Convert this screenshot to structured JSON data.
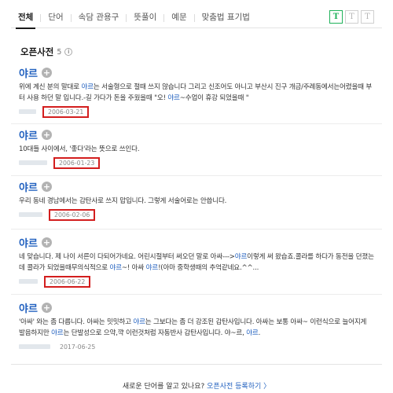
{
  "tabs": [
    {
      "label": "전체",
      "active": true
    },
    {
      "label": "단어",
      "active": false
    },
    {
      "label": "속담 관용구",
      "active": false
    },
    {
      "label": "뜻풀이",
      "active": false
    },
    {
      "label": "예문",
      "active": false
    },
    {
      "label": "맞춤법 표기법",
      "active": false
    }
  ],
  "font_buttons": [
    "T",
    "T",
    "T"
  ],
  "section": {
    "title": "오픈사전",
    "count": "5",
    "info_icon": "i"
  },
  "entries": [
    {
      "word": "야르",
      "definition": [
        {
          "t": "위에 계신 분의 말대로 "
        },
        {
          "t": "야르",
          "hl": true
        },
        {
          "t": "는 서술형으로 절때 쓰지 않습니다 그리고 신조어도 아니고 부산시 진구 개금/주례동에서는어렸을때 부터 사용 하던 말 입니다.-길 가다가 돈을 주웠을때 \"오! "
        },
        {
          "t": "야르",
          "hl": true
        },
        {
          "t": "~수업이 휴강 되었을때 \""
        }
      ],
      "date": "2006-03-21",
      "highlighted_date": true
    },
    {
      "word": "야르",
      "definition": [
        {
          "t": "10대들 사이에서, '좋다'라는 뜻으로 쓰인다."
        }
      ],
      "date": "2006-01-23",
      "highlighted_date": true
    },
    {
      "word": "야르",
      "definition": [
        {
          "t": "우리 동네 경남에서는 감탄사로 쓰지 맙입니다. 그렇게 서술어로는 안씁니다."
        }
      ],
      "date": "2006-02-06",
      "highlighted_date": true
    },
    {
      "word": "야르",
      "definition": [
        {
          "t": "네 맞습니다. 제 나이 서른이 다되어가네요. 어린시절부터 써오던 말로 아싸--->"
        },
        {
          "t": "야르",
          "hl": true
        },
        {
          "t": "이렇게 써 왔습죠.콜라를 하다가 동전을 던졌는데 콜라가 되었을때무의식적으로 "
        },
        {
          "t": "야르",
          "hl": true
        },
        {
          "t": "~! 아싸 "
        },
        {
          "t": "야르",
          "hl": true
        },
        {
          "t": "!(아마 중학생때의 추억같네요.^^..."
        }
      ],
      "date": "2006-06-22",
      "highlighted_date": true
    },
    {
      "word": "야르",
      "definition": [
        {
          "t": "'아싸' 와는 좀 다릅니다. 아싸는 밋밋하고 "
        },
        {
          "t": "야르",
          "hl": true
        },
        {
          "t": "는 그보다는 좀 더 강조된 감탄사입니다. 아싸는 보통 아싸~ 이런식으로 늘어지게 발음하지만 "
        },
        {
          "t": "야르",
          "hl": true
        },
        {
          "t": "는 단발성으로 으약,꺅 이런것처럼 자동반사 감탄사입니다. 야~르, "
        },
        {
          "t": "야르",
          "hl": true
        },
        {
          "t": ". "
        }
      ],
      "date": "2017-06-25",
      "highlighted_date": false
    }
  ],
  "footer": {
    "question": "새로운 단어를 알고 있나요?",
    "link": "오픈사전 등록하기",
    "arrow": "〉"
  },
  "colors": {
    "accent_link": "#1f5fbf",
    "highlight_box": "#d31e1e",
    "font_btn_active": "#1fb25a"
  },
  "icons": [
    "plus-icon",
    "info-icon"
  ]
}
